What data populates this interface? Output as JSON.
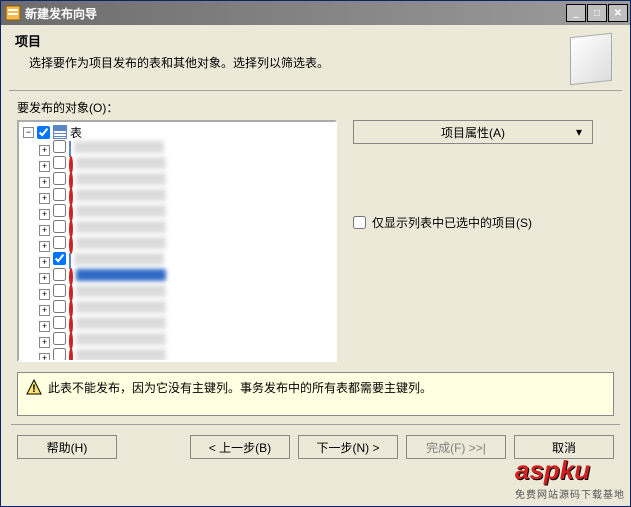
{
  "window": {
    "title": "新建发布向导"
  },
  "header": {
    "title": "项目",
    "subtitle": "选择要作为项目发布的表和其他对象。选择列以筛选表。"
  },
  "body": {
    "objects_label": "要发布的对象(O)："
  },
  "tree": {
    "root_label": "表",
    "children": [
      {
        "checked": false,
        "iconType": "table",
        "blurred": true,
        "selected": false
      },
      {
        "checked": false,
        "iconType": "forbidden",
        "blurred": true,
        "selected": false
      },
      {
        "checked": false,
        "iconType": "forbidden",
        "blurred": true,
        "selected": false
      },
      {
        "checked": false,
        "iconType": "forbidden",
        "blurred": true,
        "selected": false
      },
      {
        "checked": false,
        "iconType": "forbidden",
        "blurred": true,
        "selected": false
      },
      {
        "checked": false,
        "iconType": "forbidden",
        "blurred": true,
        "selected": false
      },
      {
        "checked": false,
        "iconType": "forbidden",
        "blurred": true,
        "selected": false
      },
      {
        "checked": true,
        "iconType": "table",
        "blurred": true,
        "selected": false
      },
      {
        "checked": false,
        "iconType": "forbidden",
        "blurred": true,
        "selected": true
      },
      {
        "checked": false,
        "iconType": "forbidden",
        "blurred": true,
        "selected": false
      },
      {
        "checked": false,
        "iconType": "forbidden",
        "blurred": true,
        "selected": false
      },
      {
        "checked": false,
        "iconType": "forbidden",
        "blurred": true,
        "selected": false
      },
      {
        "checked": false,
        "iconType": "forbidden",
        "blurred": true,
        "selected": false
      },
      {
        "checked": false,
        "iconType": "forbidden",
        "blurred": true,
        "selected": false
      }
    ]
  },
  "right": {
    "properties_button": "项目属性(A)",
    "show_selected_only": "仅显示列表中已选中的项目(S)"
  },
  "message": {
    "text": "此表不能发布，因为它没有主键列。事务发布中的所有表都需要主键列。"
  },
  "buttons": {
    "help": "帮助(H)",
    "back": "< 上一步(B)",
    "next": "下一步(N) >",
    "finish": "完成(F) >>|",
    "cancel": "取消"
  },
  "watermark": {
    "main": "aspku",
    "sub": "免费网站源码下载基地"
  }
}
